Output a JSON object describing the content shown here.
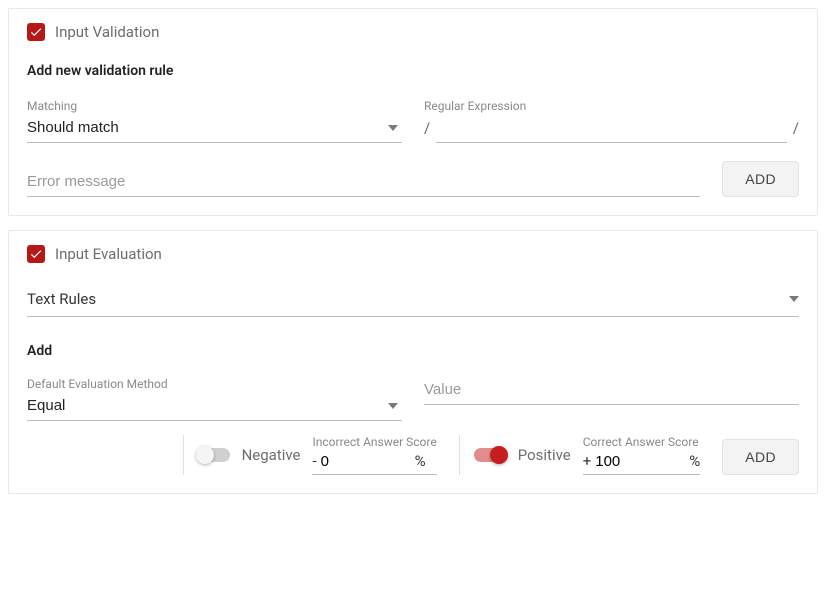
{
  "validation": {
    "title": "Input Validation",
    "subheading": "Add new validation rule",
    "matching": {
      "label": "Matching",
      "value": "Should match"
    },
    "regex": {
      "label": "Regular Expression",
      "slash": "/",
      "value": ""
    },
    "error": {
      "placeholder": "Error message",
      "value": ""
    },
    "add_button": "ADD"
  },
  "evaluation": {
    "title": "Input Evaluation",
    "rules_type": "Text Rules",
    "add_label": "Add",
    "method": {
      "label": "Default Evaluation Method",
      "value": "Equal"
    },
    "value_field": {
      "placeholder": "Value",
      "value": ""
    },
    "negative": {
      "label": "Negative",
      "score_label": "Incorrect Answer Score",
      "sign": "-",
      "value": "0",
      "pct": "%"
    },
    "positive": {
      "label": "Positive",
      "score_label": "Correct Answer Score",
      "sign": "+",
      "value": "100",
      "pct": "%"
    },
    "add_button": "ADD"
  }
}
